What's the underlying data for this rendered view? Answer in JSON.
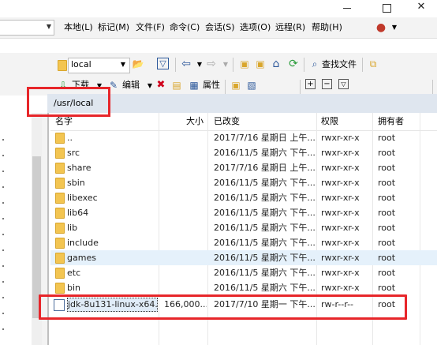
{
  "titlebar": {
    "close": "✕"
  },
  "menu": {
    "items": [
      "本地(L)",
      "标记(M)",
      "文件(F)",
      "命令(C)",
      "会话(S)",
      "选项(O)",
      "远程(R)",
      "帮助(H)"
    ]
  },
  "toolbar": {
    "location": "local",
    "find_files": "查找文件",
    "download": "下载",
    "edit": "编辑",
    "properties": "属性"
  },
  "path": "/usr/local",
  "columns": {
    "name": "名字",
    "size": "大小",
    "modified": "已改变",
    "permissions": "权限",
    "owner": "拥有者"
  },
  "rows": [
    {
      "name": "..",
      "size": "",
      "modified": "2017/7/16 星期日 上午...",
      "perm": "rwxr-xr-x",
      "owner": "root"
    },
    {
      "name": "src",
      "size": "",
      "modified": "2016/11/5 星期六 下午...",
      "perm": "rwxr-xr-x",
      "owner": "root"
    },
    {
      "name": "share",
      "size": "",
      "modified": "2017/7/16 星期日 上午...",
      "perm": "rwxr-xr-x",
      "owner": "root"
    },
    {
      "name": "sbin",
      "size": "",
      "modified": "2016/11/5 星期六 下午...",
      "perm": "rwxr-xr-x",
      "owner": "root"
    },
    {
      "name": "libexec",
      "size": "",
      "modified": "2016/11/5 星期六 下午...",
      "perm": "rwxr-xr-x",
      "owner": "root"
    },
    {
      "name": "lib64",
      "size": "",
      "modified": "2016/11/5 星期六 下午...",
      "perm": "rwxr-xr-x",
      "owner": "root"
    },
    {
      "name": "lib",
      "size": "",
      "modified": "2016/11/5 星期六 下午...",
      "perm": "rwxr-xr-x",
      "owner": "root"
    },
    {
      "name": "include",
      "size": "",
      "modified": "2016/11/5 星期六 下午...",
      "perm": "rwxr-xr-x",
      "owner": "root"
    },
    {
      "name": "games",
      "size": "",
      "modified": "2016/11/5 星期六 下午...",
      "perm": "rwxr-xr-x",
      "owner": "root"
    },
    {
      "name": "etc",
      "size": "",
      "modified": "2016/11/5 星期六 下午...",
      "perm": "rwxr-xr-x",
      "owner": "root"
    },
    {
      "name": "bin",
      "size": "",
      "modified": "2016/11/5 星期六 下午...",
      "perm": "rwxr-xr-x",
      "owner": "root"
    },
    {
      "name": "jdk-8u131-linux-x64...",
      "size": "166,000...",
      "modified": "2017/7/10 星期一 下午...",
      "perm": "rw-r--r--",
      "owner": "root"
    }
  ],
  "colors": {
    "highlight": "#e7262a",
    "pathbar": "#dfe6ef",
    "folder": "#f3c551"
  }
}
